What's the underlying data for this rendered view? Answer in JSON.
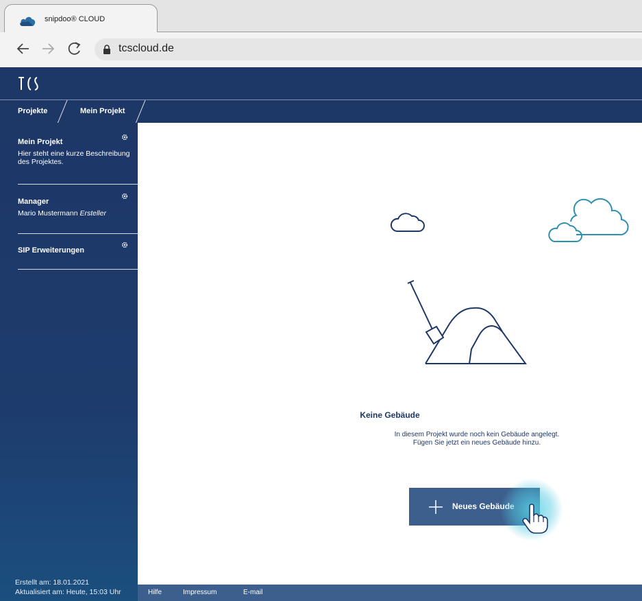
{
  "browser": {
    "tab_title": "snipdoo® CLOUD",
    "url": "tcscloud.de"
  },
  "breadcrumb": [
    "Projekte",
    "Mein Projekt"
  ],
  "sidebar": {
    "sections": [
      {
        "title": "Mein Projekt",
        "text": "Hier steht eine kurze Beschreibung des Projektes."
      },
      {
        "title": "Manager",
        "text": "Mario Mustermann",
        "text_italic": "Ersteller"
      },
      {
        "title": "SIP Erweiterungen",
        "text": ""
      }
    ],
    "created": "Erstellt am: 18.01.2021",
    "updated": "Aktualisiert am: Heute, 15:03 Uhr"
  },
  "main": {
    "empty_title": "Keine Gebäude",
    "empty_text_line1": "In diesem Projekt wurde noch kein Gebäude angelegt.",
    "empty_text_line2": "Fügen Sie jetzt ein neues Gebäude hinzu.",
    "new_button_label": "Neues Gebäude"
  },
  "footer": {
    "links": [
      "Hilfe",
      "Impressum",
      "E-mail"
    ]
  },
  "colors": {
    "navy": "#1d3767",
    "button_blue": "#3d5f8e",
    "accent_teal": "#2e8fb0"
  }
}
